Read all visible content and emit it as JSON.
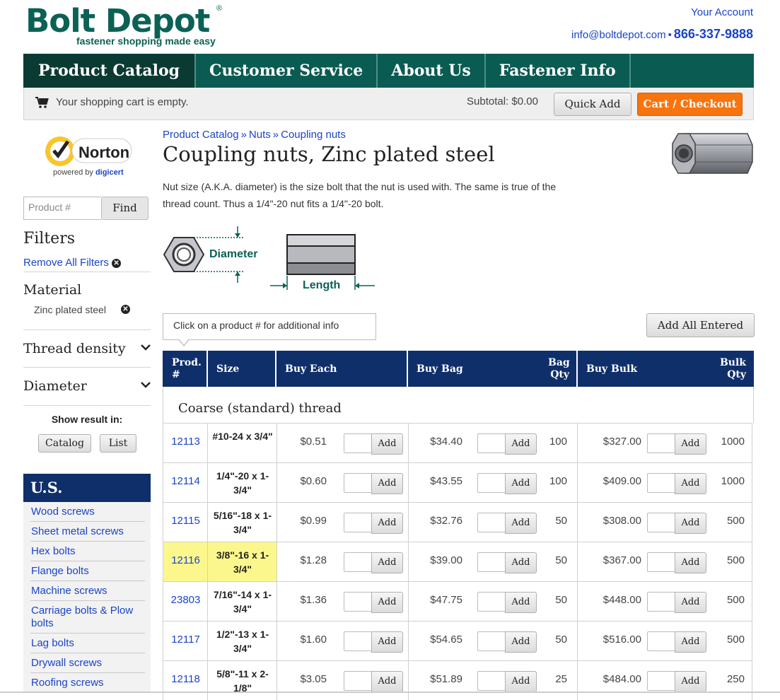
{
  "brand": {
    "name": "Bolt Depot",
    "registered": "®",
    "tagline": "fastener shopping made easy"
  },
  "header": {
    "your_account": "Your Account",
    "email": "info@boltdepot.com",
    "separator": "•",
    "phone": "866-337-9888"
  },
  "nav": {
    "items": [
      "Product Catalog",
      "Customer Service",
      "About Us",
      "Fastener Info"
    ]
  },
  "cart": {
    "status": "Your shopping cart is empty.",
    "subtotal": "Subtotal: $0.00",
    "quick_add": "Quick Add",
    "checkout": "Cart / Checkout"
  },
  "norton": {
    "name": "Norton",
    "powered": "powered by",
    "digicert": "digicert"
  },
  "search": {
    "placeholder": "Product #",
    "button": "Find"
  },
  "filters": {
    "heading": "Filters",
    "remove_all": "Remove All Filters",
    "material_heading": "Material",
    "material_value": "Zinc plated steel",
    "facets": [
      "Thread density",
      "Diameter"
    ],
    "show_result_in": "Show result in:",
    "view_buttons": [
      "Catalog",
      "List"
    ]
  },
  "us_menu": {
    "heading": "U.S.",
    "items": [
      "Wood screws",
      "Sheet metal screws",
      "Hex bolts",
      "Flange bolts",
      "Machine screws",
      "Carriage bolts & Plow bolts",
      "Lag bolts",
      "Drywall screws",
      "Roofing screws"
    ]
  },
  "breadcrumb": [
    "Product Catalog",
    "Nuts",
    "Coupling nuts"
  ],
  "breadcrumb_sep": "»",
  "page": {
    "title": "Coupling nuts, Zinc plated steel",
    "description": "Nut size (A.K.A. diameter) is the size bolt that the nut is used with. The same is true of the thread count. Thus a 1/4\"-20 nut fits a 1/4\"-20 bolt.",
    "diagram_diameter": "Diameter",
    "diagram_length": "Length",
    "hint": "Click on a product # for additional info",
    "add_all": "Add All Entered"
  },
  "table": {
    "headers": {
      "prod": "Prod. #",
      "size": "Size",
      "buy_each": "Buy Each",
      "buy_bag": "Buy Bag",
      "bag_qty": "Bag Qty",
      "buy_bulk": "Buy Bulk",
      "bulk_qty": "Bulk Qty"
    },
    "section": "Coarse (standard) thread",
    "add_label": "Add",
    "rows": [
      {
        "prod": "12113",
        "size": "#10-24 x 3/4\"",
        "each": "$0.51",
        "bag": "$34.40",
        "bag_qty": "100",
        "bulk": "$327.00",
        "bulk_qty": "1000"
      },
      {
        "prod": "12114",
        "size": "1/4\"-20 x 1-3/4\"",
        "each": "$0.60",
        "bag": "$43.55",
        "bag_qty": "100",
        "bulk": "$409.00",
        "bulk_qty": "1000"
      },
      {
        "prod": "12115",
        "size": "5/16\"-18 x 1-3/4\"",
        "each": "$0.99",
        "bag": "$32.76",
        "bag_qty": "50",
        "bulk": "$308.00",
        "bulk_qty": "500"
      },
      {
        "prod": "12116",
        "size": "3/8\"-16 x 1-3/4\"",
        "each": "$1.28",
        "bag": "$39.00",
        "bag_qty": "50",
        "bulk": "$367.00",
        "bulk_qty": "500",
        "highlight": true
      },
      {
        "prod": "23803",
        "size": "7/16\"-14 x 1-3/4\"",
        "each": "$1.36",
        "bag": "$47.75",
        "bag_qty": "50",
        "bulk": "$448.00",
        "bulk_qty": "500"
      },
      {
        "prod": "12117",
        "size": "1/2\"-13 x 1-3/4\"",
        "each": "$1.60",
        "bag": "$54.65",
        "bag_qty": "50",
        "bulk": "$516.00",
        "bulk_qty": "500"
      },
      {
        "prod": "12118",
        "size": "5/8\"-11 x 2-1/8\"",
        "each": "$3.05",
        "bag": "$51.89",
        "bag_qty": "25",
        "bulk": "$484.00",
        "bulk_qty": "250"
      }
    ]
  },
  "colors": {
    "brand_green": "#0c6155",
    "nav_bg": "#0a5b52",
    "nav_active": "#0b3a33",
    "table_header": "#0f2f6a",
    "checkout": "#f7740e",
    "highlight": "#fbf78c",
    "link": "#1a44c8"
  }
}
